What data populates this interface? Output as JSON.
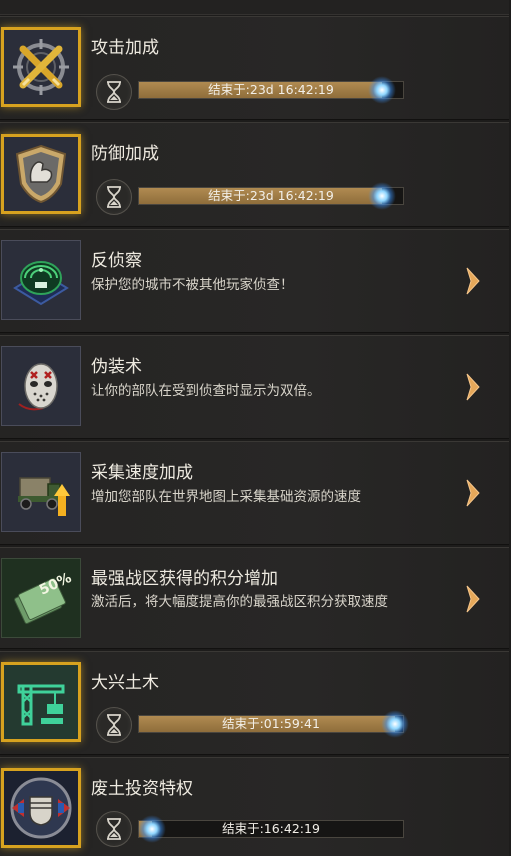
{
  "boosts": [
    {
      "id": "attack",
      "title": "攻击加成",
      "icon": "crossed-bullets-icon",
      "active": true,
      "timer_label": "结束于:23d 16:42:19",
      "progress": 0.92
    },
    {
      "id": "defense",
      "title": "防御加成",
      "icon": "bicep-shield-icon",
      "active": true,
      "timer_label": "结束于:23d 16:42:19",
      "progress": 0.92
    },
    {
      "id": "anti-scout",
      "title": "反侦察",
      "icon": "radar-icon",
      "active": false,
      "description": "保护您的城市不被其他玩家侦查！"
    },
    {
      "id": "disguise",
      "title": "伪装术",
      "icon": "hockey-mask-icon",
      "active": false,
      "description": "让你的部队在受到侦查时显示为双倍。"
    },
    {
      "id": "gathering",
      "title": "采集速度加成",
      "icon": "truck-arrow-icon",
      "active": false,
      "description": "增加您部队在世界地图上采集基础资源的速度"
    },
    {
      "id": "war-zone",
      "title": "最强战区获得的积分增加",
      "icon": "fifty-percent-cards-icon",
      "active": false,
      "description": "激活后，将大幅度提高你的最强战区积分获取速度"
    },
    {
      "id": "construction",
      "title": "大兴土木",
      "icon": "crane-icon",
      "active": true,
      "timer_label": "结束于:01:59:41",
      "progress": 0.97
    },
    {
      "id": "wasteland-investment",
      "title": "废土投资特权",
      "icon": "fist-badge-icon",
      "active": true,
      "timer_label": "结束于:16:42:19",
      "progress": 0.05
    }
  ],
  "colors": {
    "gold_border": "#d7a21f",
    "progress_fill": "#a07e47",
    "arrow": "#e6a85a",
    "background": "#1d1c1b"
  }
}
